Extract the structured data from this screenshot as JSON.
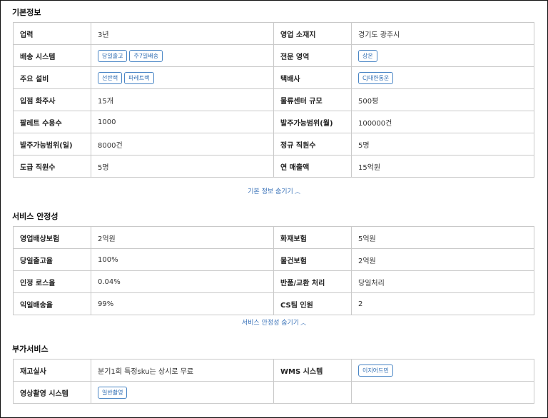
{
  "basic": {
    "title": "기본정보",
    "toggle_label": "기본 정보 숨기기",
    "rows": [
      {
        "l1": "업력",
        "v1": "3년",
        "l2": "영업 소재지",
        "v2": "경기도 광주시"
      },
      {
        "l1": "배송 시스템",
        "tags1": [
          "당일출고",
          "주7일배송"
        ],
        "l2": "전문 영역",
        "tags2": [
          "상온"
        ]
      },
      {
        "l1": "주요 설비",
        "tags1": [
          "선반랙",
          "파레트랙"
        ],
        "l2": "택배사",
        "tags2": [
          "CJ대한통운"
        ]
      },
      {
        "l1": "입점 화주사",
        "v1": "15개",
        "l2": "물류센터 규모",
        "v2": "500평"
      },
      {
        "l1": "팔레트 수용수",
        "v1": "1000",
        "l2": "발주가능범위(월)",
        "v2": "100000건"
      },
      {
        "l1": "발주가능범위(일)",
        "v1": "8000건",
        "l2": "정규 직원수",
        "v2": "5명"
      },
      {
        "l1": "도급 직원수",
        "v1": "5명",
        "l2": "연 매출액",
        "v2": "15억원"
      }
    ]
  },
  "stability": {
    "title": "서비스 안정성",
    "toggle_label": "서비스 안정성 숨기기",
    "rows": [
      {
        "l1": "영업배상보험",
        "v1": "2억원",
        "l2": "화재보험",
        "v2": "5억원"
      },
      {
        "l1": "당일출고율",
        "v1": "100%",
        "l2": "물건보험",
        "v2": "2억원"
      },
      {
        "l1": "인정 로스율",
        "v1": "0.04%",
        "l2": "반품/교환 처리",
        "v2": "당일처리"
      },
      {
        "l1": "익일배송율",
        "v1": "99%",
        "l2": "CS팀 인원",
        "v2": "2"
      }
    ]
  },
  "extra": {
    "title": "부가서비스",
    "rows": [
      {
        "l1": "재고실사",
        "v1": "분기1회 특정sku는 상시로 무료",
        "l2": "WMS 시스템",
        "tags2": [
          "이지어드민"
        ]
      },
      {
        "l1": "영상촬영 시스템",
        "tags1": [
          "일반촬영"
        ],
        "l2": "",
        "v2": ""
      }
    ]
  }
}
